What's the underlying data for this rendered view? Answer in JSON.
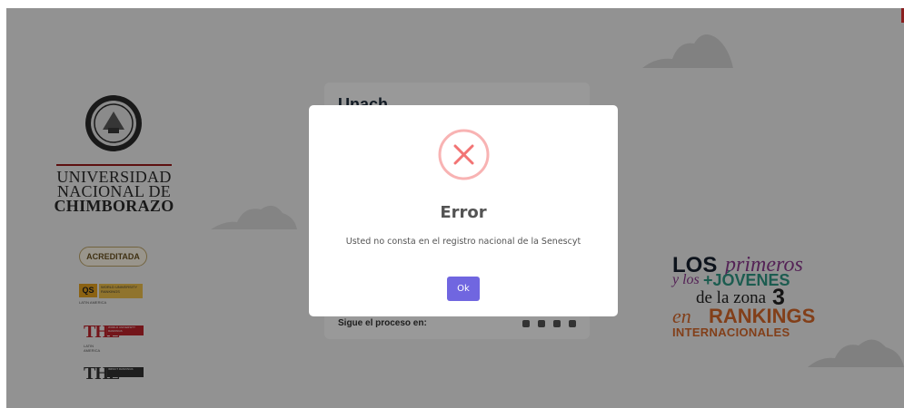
{
  "background": {
    "university": {
      "name_lines": [
        "UNIVERSIDAD",
        "NACIONAL DE",
        "CHIMBORAZO"
      ],
      "seal_icon": "university-seal-icon"
    },
    "badges": {
      "acreditada": "ACREDITADA",
      "qs": {
        "mark": "QS",
        "text": "WORLD UNIVERSITY RANKINGS",
        "sub": "LATIN AMERICA"
      },
      "the_1": {
        "mark": "THE",
        "text": "WORLD UNIVERSITY RANKINGS",
        "sub": "LATIN AMERICA"
      },
      "the_2": {
        "mark": "THE",
        "text": "IMPACT RANKINGS"
      }
    },
    "card": {
      "title": "Unach",
      "footer_text": "Sigue el proceso en:",
      "social_icons": [
        "facebook-icon",
        "twitter-icon",
        "youtube-icon",
        "instagram-icon"
      ]
    },
    "slogan": {
      "line1_a": "LOS",
      "line1_b": "primeros",
      "line2_a": "y los",
      "line2_b": "+JÓVENES",
      "line3_a": "de la zona",
      "line3_b": "3",
      "line4_a": "en",
      "line4_b": "RANKINGS",
      "line5": "INTERNACIONALES"
    }
  },
  "modal": {
    "icon": "error-x-icon",
    "title": "Error",
    "message": "Usted no consta en el registro nacional de la Senescyt",
    "ok_label": "Ok"
  },
  "colors": {
    "error_icon": "#f27474",
    "confirm_button": "#7066e0",
    "overlay": "rgba(0,0,0,0.4)"
  }
}
